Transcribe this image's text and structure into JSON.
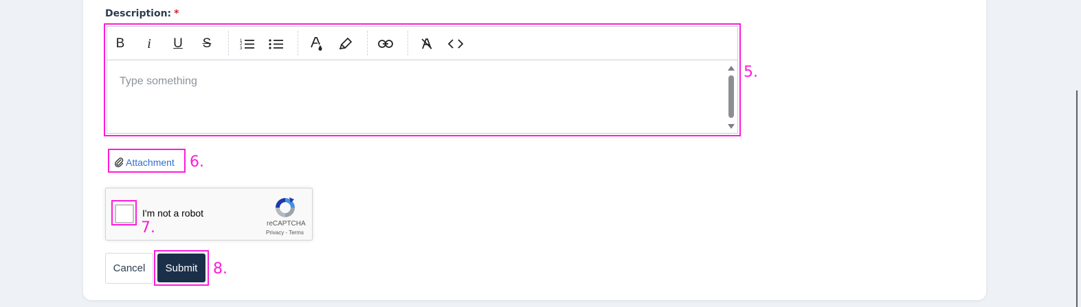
{
  "description": {
    "label": "Description:",
    "required_mark": "*"
  },
  "editor": {
    "placeholder": "Type something",
    "toolbar": [
      {
        "name": "bold-icon",
        "glyph": "B"
      },
      {
        "name": "italic-icon",
        "glyph": "i"
      },
      {
        "name": "underline-icon",
        "glyph": "U"
      },
      {
        "name": "strikethrough-icon",
        "glyph": "S"
      },
      {
        "name": "ordered-list-icon"
      },
      {
        "name": "bullet-list-icon"
      },
      {
        "name": "text-color-icon"
      },
      {
        "name": "highlight-icon"
      },
      {
        "name": "link-icon"
      },
      {
        "name": "clear-format-icon"
      },
      {
        "name": "code-icon"
      }
    ]
  },
  "attachment": {
    "label": "Attachment"
  },
  "captcha": {
    "label": "I'm not a robot",
    "brand": "reCAPTCHA",
    "links": "Privacy - Terms"
  },
  "buttons": {
    "cancel": "Cancel",
    "submit": "Submit"
  },
  "annotations": {
    "editor": "5.",
    "attachment": "6.",
    "captcha_checkbox": "7.",
    "submit": "8."
  },
  "colors": {
    "highlight": "#ff1ad9",
    "submit_bg": "#1b2f49",
    "link": "#2f6fd1",
    "required": "#c62828"
  }
}
